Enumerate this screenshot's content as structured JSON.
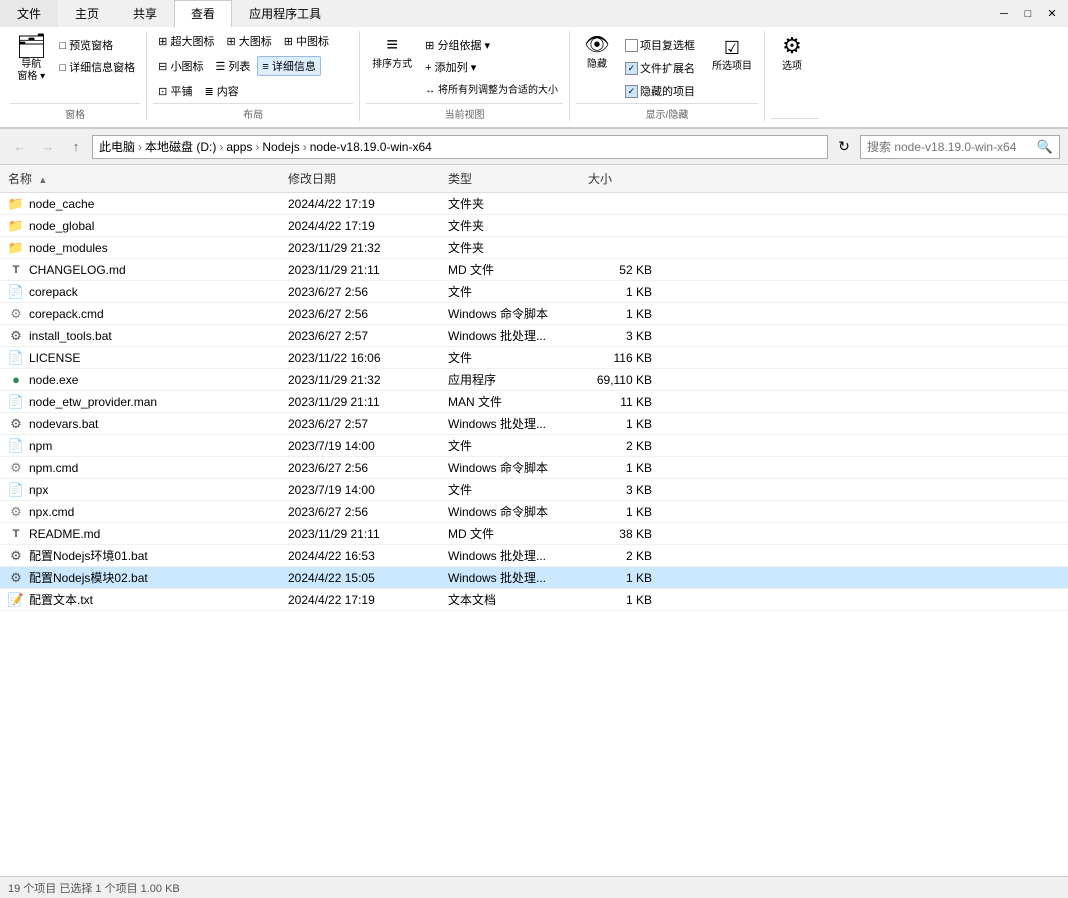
{
  "window": {
    "title": "node-v18.19.0-win-x64"
  },
  "menu_tabs": [
    "文件",
    "主页",
    "共享",
    "查看",
    "应用程序工具"
  ],
  "active_tab": "查看",
  "ribbon": {
    "groups": [
      {
        "label": "窗格",
        "items": [
          {
            "label": "导航窗格",
            "type": "big",
            "icon": "🗂"
          },
          {
            "label": "预览窗格",
            "type": "small"
          },
          {
            "label": "详细信息窗格",
            "type": "small"
          }
        ]
      },
      {
        "label": "布局",
        "items": [
          {
            "label": "超大图标",
            "type": "small"
          },
          {
            "label": "大图标",
            "type": "small"
          },
          {
            "label": "中图标",
            "type": "small"
          },
          {
            "label": "小图标",
            "type": "small"
          },
          {
            "label": "列表",
            "type": "small"
          },
          {
            "label": "详细信息",
            "type": "small",
            "active": true
          },
          {
            "label": "平铺",
            "type": "small"
          },
          {
            "label": "内容",
            "type": "small"
          }
        ]
      },
      {
        "label": "当前视图",
        "items": [
          {
            "label": "排序方式",
            "type": "big",
            "icon": "≡"
          },
          {
            "label": "分组依据",
            "type": "small"
          },
          {
            "label": "添加列",
            "type": "small"
          },
          {
            "label": "将所有列调整为合适的大小",
            "type": "small"
          }
        ]
      },
      {
        "label": "显示/隐藏",
        "items": [
          {
            "label": "隐藏",
            "type": "big",
            "icon": "👁"
          },
          {
            "label": "项目复选框",
            "type": "checkbox",
            "checked": false
          },
          {
            "label": "文件扩展名",
            "type": "checkbox",
            "checked": true
          },
          {
            "label": "隐藏的项目",
            "type": "checkbox",
            "checked": true
          },
          {
            "label": "所选项目",
            "type": "small"
          }
        ]
      },
      {
        "label": "",
        "items": [
          {
            "label": "选项",
            "type": "big",
            "icon": "⚙"
          }
        ]
      }
    ]
  },
  "address": {
    "path_parts": [
      "此电脑",
      "本地磁盘 (D:)",
      "apps",
      "Nodejs",
      "node-v18.19.0-win-x64"
    ],
    "search_placeholder": "搜索 node-v18.19.0-win-x64"
  },
  "columns": [
    {
      "label": "名称",
      "key": "name"
    },
    {
      "label": "修改日期",
      "key": "date"
    },
    {
      "label": "类型",
      "key": "type"
    },
    {
      "label": "大小",
      "key": "size"
    }
  ],
  "files": [
    {
      "name": "node_cache",
      "date": "2024/4/22 17:19",
      "type": "文件夹",
      "size": "",
      "icon": "folder"
    },
    {
      "name": "node_global",
      "date": "2024/4/22 17:19",
      "type": "文件夹",
      "size": "",
      "icon": "folder"
    },
    {
      "name": "node_modules",
      "date": "2023/11/29 21:32",
      "type": "文件夹",
      "size": "",
      "icon": "folder"
    },
    {
      "name": "CHANGELOG.md",
      "date": "2023/11/29 21:11",
      "type": "MD 文件",
      "size": "52 KB",
      "icon": "md"
    },
    {
      "name": "corepack",
      "date": "2023/6/27 2:56",
      "type": "文件",
      "size": "1 KB",
      "icon": "file"
    },
    {
      "name": "corepack.cmd",
      "date": "2023/6/27 2:56",
      "type": "Windows 命令脚本",
      "size": "1 KB",
      "icon": "cmd"
    },
    {
      "name": "install_tools.bat",
      "date": "2023/6/27 2:57",
      "type": "Windows 批处理...",
      "size": "3 KB",
      "icon": "bat"
    },
    {
      "name": "LICENSE",
      "date": "2023/11/22 16:06",
      "type": "文件",
      "size": "116 KB",
      "icon": "file"
    },
    {
      "name": "node.exe",
      "date": "2023/11/29 21:32",
      "type": "应用程序",
      "size": "69,110 KB",
      "icon": "exe"
    },
    {
      "name": "node_etw_provider.man",
      "date": "2023/11/29 21:11",
      "type": "MAN 文件",
      "size": "11 KB",
      "icon": "man"
    },
    {
      "name": "nodevars.bat",
      "date": "2023/6/27 2:57",
      "type": "Windows 批处理...",
      "size": "1 KB",
      "icon": "bat"
    },
    {
      "name": "npm",
      "date": "2023/7/19 14:00",
      "type": "文件",
      "size": "2 KB",
      "icon": "file"
    },
    {
      "name": "npm.cmd",
      "date": "2023/6/27 2:56",
      "type": "Windows 命令脚本",
      "size": "1 KB",
      "icon": "cmd"
    },
    {
      "name": "npx",
      "date": "2023/7/19 14:00",
      "type": "文件",
      "size": "3 KB",
      "icon": "file"
    },
    {
      "name": "npx.cmd",
      "date": "2023/6/27 2:56",
      "type": "Windows 命令脚本",
      "size": "1 KB",
      "icon": "cmd"
    },
    {
      "name": "README.md",
      "date": "2023/11/29 21:11",
      "type": "MD 文件",
      "size": "38 KB",
      "icon": "md"
    },
    {
      "name": "配置Nodejs环境01.bat",
      "date": "2024/4/22 16:53",
      "type": "Windows 批处理...",
      "size": "2 KB",
      "icon": "bat"
    },
    {
      "name": "配置Nodejs模块02.bat",
      "date": "2024/4/22 15:05",
      "type": "Windows 批处理...",
      "size": "1 KB",
      "icon": "bat",
      "selected": true
    },
    {
      "name": "配置文本.txt",
      "date": "2024/4/22 17:19",
      "type": "文本文档",
      "size": "1 KB",
      "icon": "txt"
    }
  ],
  "status": "19 个项目  已选择 1 个项目  1.00 KB"
}
